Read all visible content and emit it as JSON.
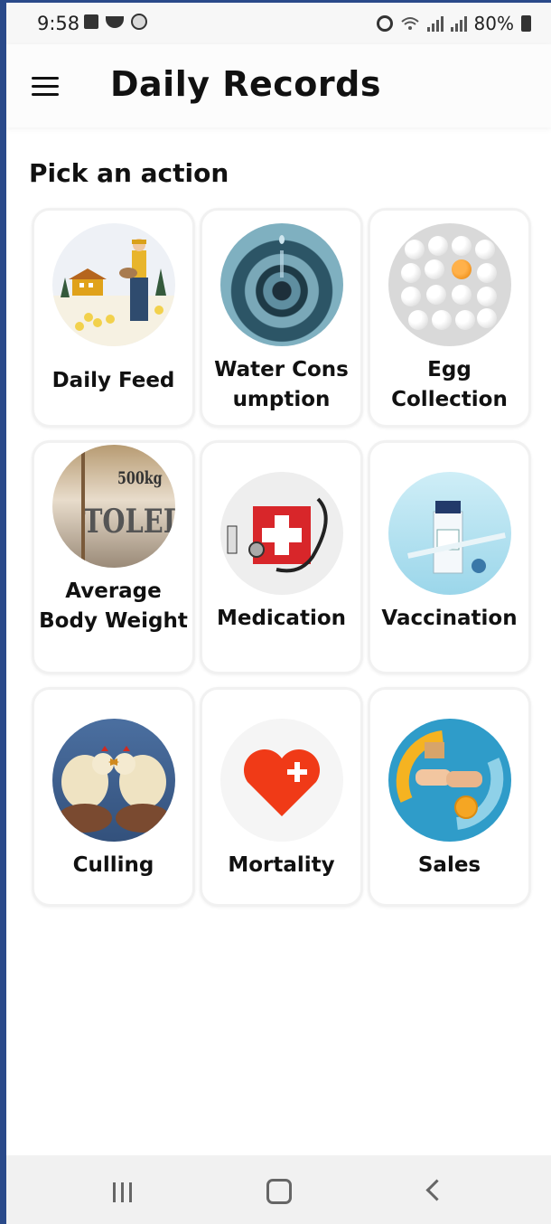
{
  "status_bar": {
    "time": "9:58",
    "battery": "80%",
    "left_icons": [
      "image-icon",
      "bowl-icon",
      "face-icon"
    ],
    "right_icons": [
      "alarm-icon",
      "wifi-icon",
      "signal-icon",
      "signal-icon",
      "battery-icon"
    ]
  },
  "app_bar": {
    "title": "Daily Records",
    "menu_icon": "hamburger-menu-icon"
  },
  "section_title": "Pick an action",
  "actions": [
    {
      "label": "Daily Feed",
      "icon": "farmer-feeding-chicks-image"
    },
    {
      "label": "Water Cons umption",
      "icon": "water-drop-image"
    },
    {
      "label": "Egg Collection",
      "icon": "eggs-image"
    },
    {
      "label": "Average Body Weight",
      "icon": "scale-image"
    },
    {
      "label": "Medication",
      "icon": "first-aid-stethoscope-image"
    },
    {
      "label": "Vaccination",
      "icon": "vaccine-vial-syringe-image"
    },
    {
      "label": "Culling",
      "icon": "hands-holding-chickens-image"
    },
    {
      "label": "Mortality",
      "icon": "heart-plus-image"
    },
    {
      "label": "Sales",
      "icon": "handshake-coin-image"
    }
  ],
  "weight_image_text": {
    "capacity": "500kg",
    "brand": "TOLEDO"
  },
  "colors": {
    "accent_heart": "#f03a17",
    "card_border": "#f1f1f1",
    "title_text": "#111111"
  },
  "nav_bar": {
    "buttons": [
      "recents-icon",
      "home-icon",
      "back-icon"
    ]
  }
}
